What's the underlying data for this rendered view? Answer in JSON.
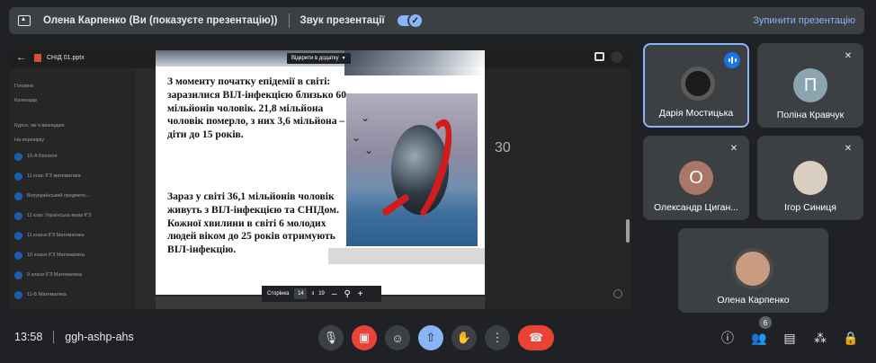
{
  "top_bar": {
    "presenter_text": "Олена Карпенко (Ви (показуєте презентацію))",
    "sound_label": "Звук презентації",
    "sound_toggle_on": true,
    "stop_label": "Зупинити презентацію"
  },
  "shared_app": {
    "filename": "СНІД 01.pptx",
    "open_with_label": "Відкрити в додатку",
    "bg_number": "30",
    "sidebar_rows": [
      "Головна",
      "Календар",
      "Курси, які я викладаю",
      "На перевірку",
      "10-А Біологія",
      "11 клас ІГЗ математика",
      "Всеукраїнський предметн...",
      "11 клас Українська мова ІГЗ",
      "11 класи ІГЗ Математика",
      "10 класи ІГЗ Математика",
      "9 класи ІГЗ Математика",
      "11-Б Математика"
    ]
  },
  "slide": {
    "paragraph_1": "З моменту початку епідемії в світі: заразилися ВІЛ-інфекцією близько 60 мільйонів чоловік. 21,8 мільйона чоловік померло, з них 3,6 мільйона – діти до 15 років.",
    "paragraph_2": "Зараз у світі 36,1 мільйонів чоловік живуть з ВІЛ-інфекцією та СНІДом. Кожної хвилини в світі 6 молодих людей віком до 25 років отримують  ВІЛ-інфекцію."
  },
  "pager": {
    "label": "Сторінка",
    "current": "14",
    "separator": "з",
    "total": "19",
    "zoom_out": "–",
    "zoom_in": "+"
  },
  "participants": [
    {
      "name": "Дарія Мостицька",
      "initial": "",
      "speaking": true
    },
    {
      "name": "Поліна Кравчук",
      "initial": "П",
      "color": "#8ba5ae"
    },
    {
      "name": "Олександр Циган...",
      "initial": "О",
      "color": "#a8776a"
    },
    {
      "name": "Ігор Синиця",
      "initial": ""
    },
    {
      "name": "Олена Карпенко",
      "initial": ""
    }
  ],
  "bottom_bar": {
    "time": "13:58",
    "meeting_code": "ggh-ashp-ahs",
    "people_count": "6"
  }
}
